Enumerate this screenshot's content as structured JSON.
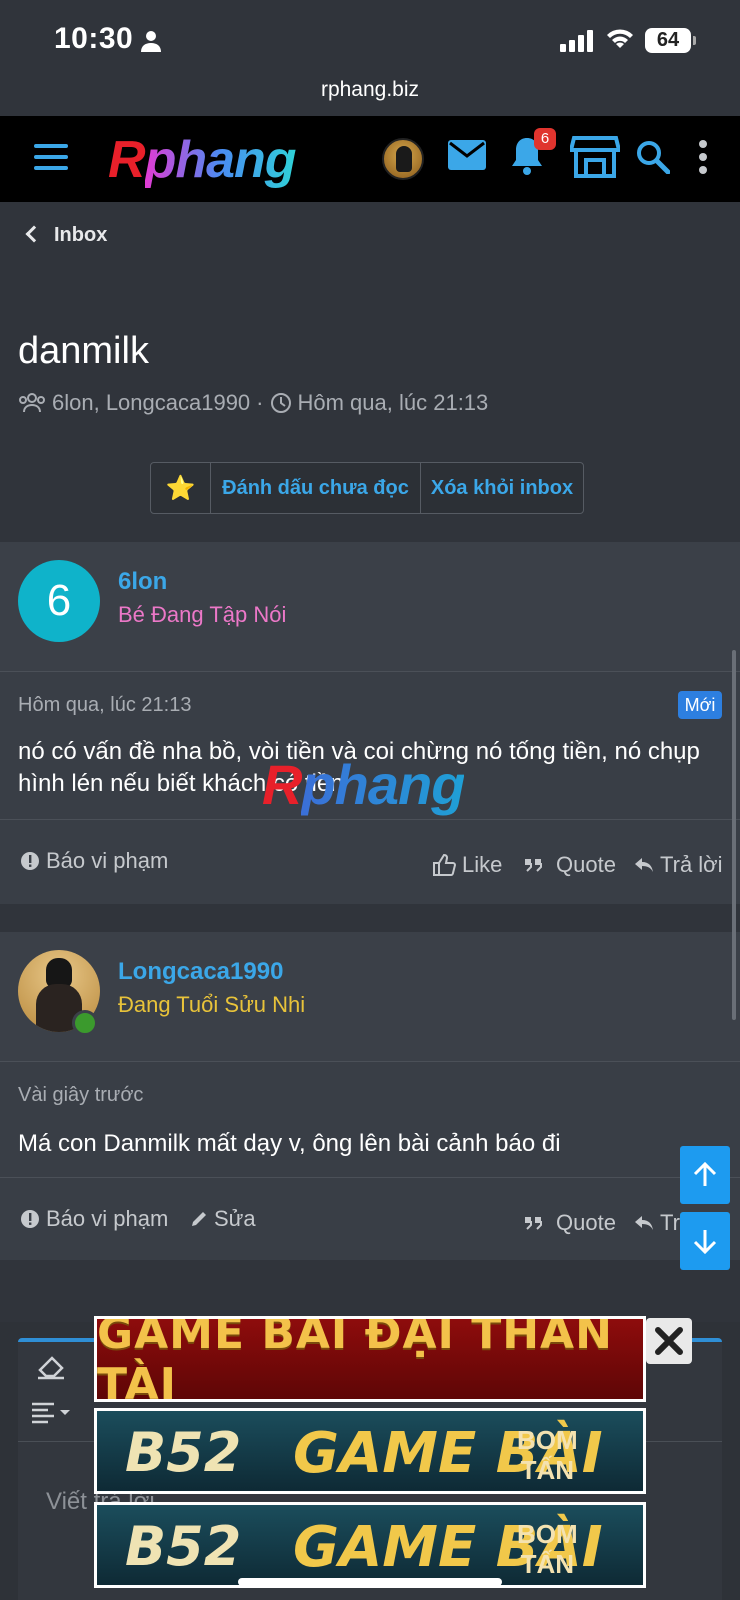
{
  "status_bar": {
    "time": "10:30",
    "battery": "64"
  },
  "url": "rphang.biz",
  "nav": {
    "logo_r": "R",
    "logo_rest": "phang",
    "notification_count": "6"
  },
  "breadcrumb": "Inbox",
  "conversation": {
    "title": "danmilk",
    "participants": "6lon, Longcaca1990",
    "time": "Hôm qua, lúc 21:13"
  },
  "actions": {
    "star": "⭐",
    "mark_unread": "Đánh dấu chưa đọc",
    "remove_inbox": "Xóa khỏi inbox"
  },
  "messages": [
    {
      "avatar_letter": "6",
      "username": "6lon",
      "user_title": "Bé Đang Tập Nói",
      "user_title_color": "#ec78c8",
      "time": "Hôm qua, lúc 21:13",
      "new_label": "Mới",
      "body": "nó có vấn đề nha bồ, vòi tiền và coi chừng nó tống tiền, nó chụp hình lén nếu biết khách có tiền",
      "report": "Báo vi phạm",
      "like": "Like",
      "quote": "Quote",
      "reply": "Trả lời"
    },
    {
      "username": "Longcaca1990",
      "user_title": "Đang Tuổi Sửu Nhi",
      "user_title_color": "#e8c33a",
      "time": "Vài giây trước",
      "body": "Má con Danmilk mất dạy v, ông lên bài cảnh báo đi",
      "report": "Báo vi phạm",
      "edit": "Sửa",
      "quote": "Quote",
      "reply": "Trả lời"
    }
  ],
  "watermark": {
    "r": "R",
    "rest": "phang"
  },
  "editor": {
    "placeholder": "Viết trả lời..."
  },
  "ads": [
    {
      "text": "GAME BÀI ĐẠI THẦN TÀI"
    },
    {
      "brand": "B52",
      "text": "GAME BÀI",
      "tag_line1": "BOM",
      "tag_line2": "TẤN"
    },
    {
      "brand": "B52",
      "text": "GAME BÀI",
      "tag_line1": "BOM",
      "tag_line2": "TẤN"
    }
  ]
}
